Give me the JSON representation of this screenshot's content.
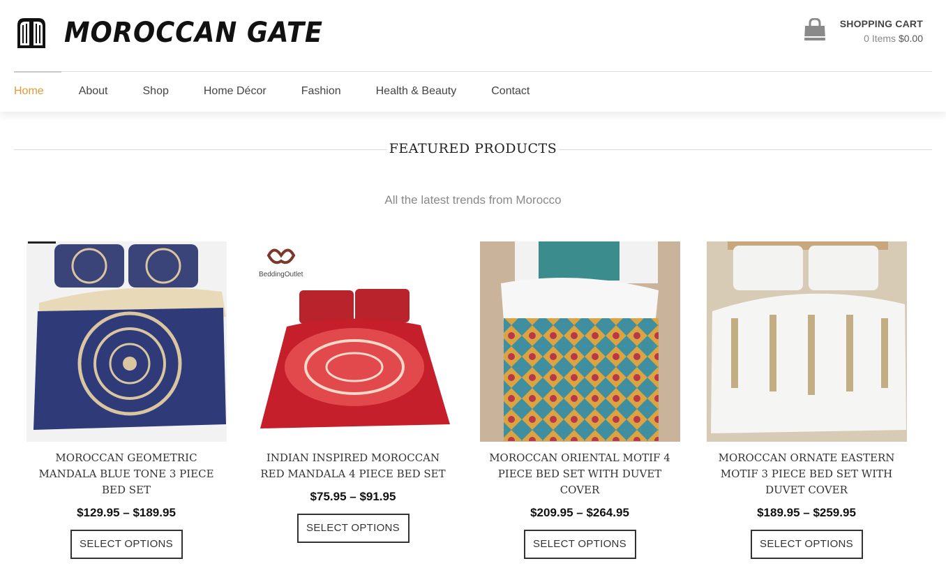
{
  "brand": {
    "name": "MOROCCAN GATE"
  },
  "cart": {
    "title": "SHOPPING CART",
    "items": "0 Items",
    "total": "$0.00"
  },
  "nav": [
    {
      "label": "Home",
      "active": true
    },
    {
      "label": "About"
    },
    {
      "label": "Shop"
    },
    {
      "label": "Home Décor"
    },
    {
      "label": "Fashion"
    },
    {
      "label": "Health & Beauty"
    },
    {
      "label": "Contact"
    }
  ],
  "section": {
    "title": "FEATURED PRODUCTS",
    "subtitle": "All the latest trends from Morocco"
  },
  "products": [
    {
      "title": "MOROCCAN GEOMETRIC MANDALA BLUE TONE 3 PIECE BED SET",
      "price": "$129.95 – $189.95",
      "button": "SELECT OPTIONS"
    },
    {
      "title": "INDIAN INSPIRED MOROCCAN RED MANDALA 4 PIECE BED SET",
      "price": "$75.95 – $91.95",
      "button": "SELECT OPTIONS",
      "image_text": "BeddingOutlet"
    },
    {
      "title": "MOROCCAN ORIENTAL MOTIF 4 PIECE BED SET WITH DUVET COVER",
      "price": "$209.95 – $264.95",
      "button": "SELECT OPTIONS"
    },
    {
      "title": "MOROCCAN ORNATE EASTERN MOTIF 3 PIECE BED SET WITH DUVET COVER",
      "price": "$189.95 – $259.95",
      "button": "SELECT OPTIONS"
    }
  ],
  "colors": {
    "accent": "#e29a34",
    "text": "#333333",
    "muted": "#888888"
  },
  "icons": {
    "logo": "moroccan-gate-door-icon",
    "cart": "shopping-bag-icon"
  }
}
